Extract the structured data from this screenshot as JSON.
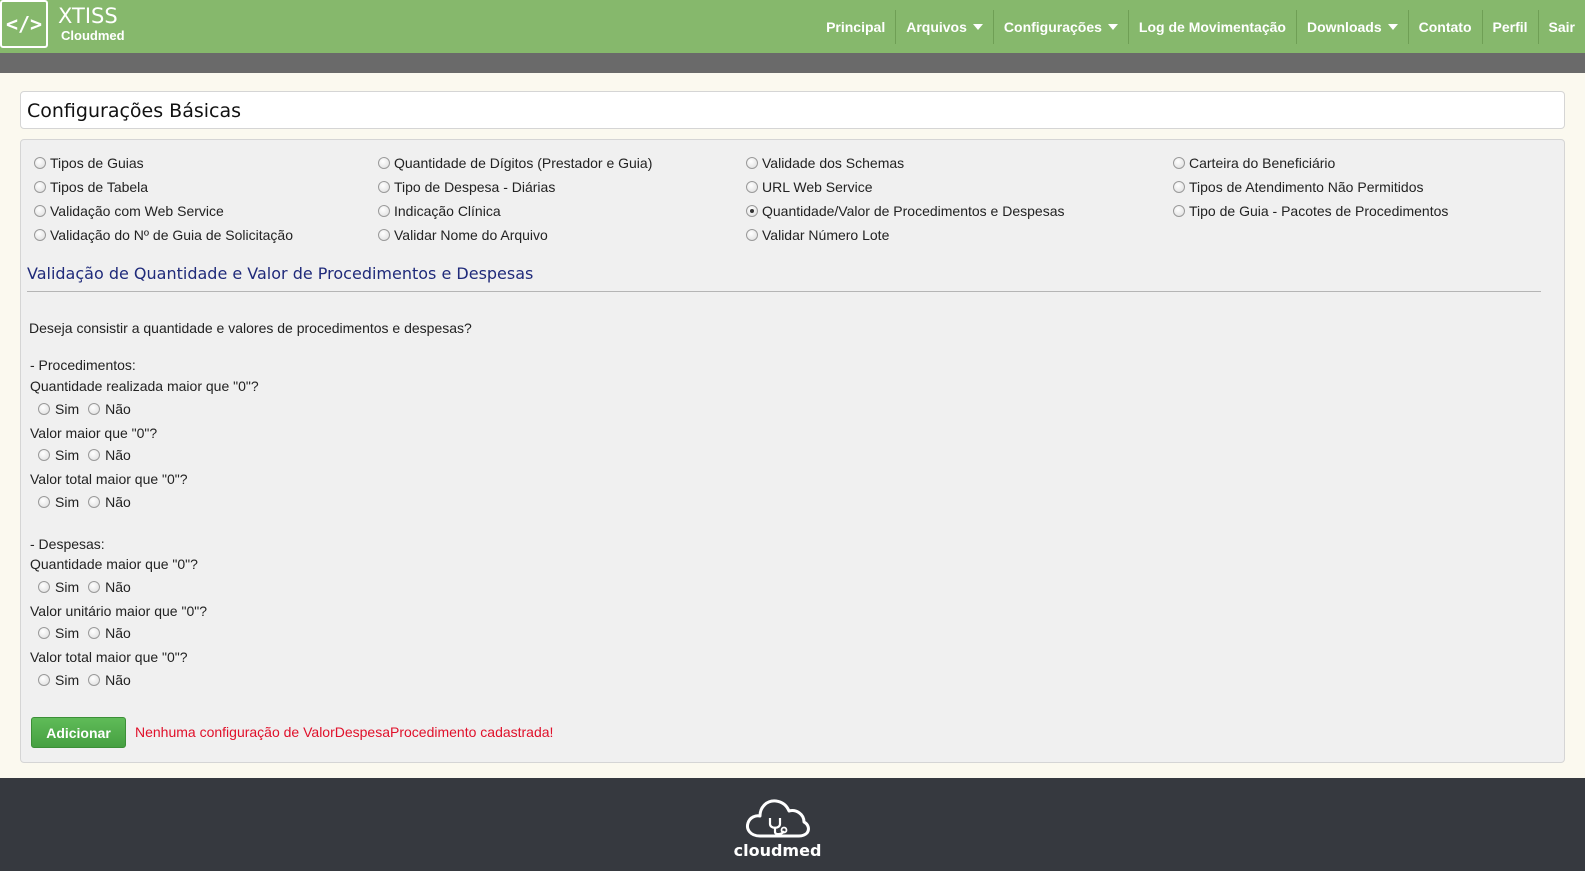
{
  "header": {
    "brand": "XTISS",
    "brand_sub": "Cloudmed",
    "logo_glyph": "</>",
    "nav": [
      {
        "label": "Principal",
        "dropdown": false
      },
      {
        "label": "Arquivos",
        "dropdown": true
      },
      {
        "label": "Configurações",
        "dropdown": true
      },
      {
        "label": "Log de Movimentação",
        "dropdown": false
      },
      {
        "label": "Downloads",
        "dropdown": true
      },
      {
        "label": "Contato",
        "dropdown": false
      },
      {
        "label": "Perfil",
        "dropdown": false
      },
      {
        "label": "Sair",
        "dropdown": false
      }
    ]
  },
  "page_title": "Configurações Básicas",
  "options": [
    {
      "label": "Tipos de Guias",
      "checked": false
    },
    {
      "label": "Tipos de Tabela",
      "checked": false
    },
    {
      "label": "Validação com Web Service",
      "checked": false
    },
    {
      "label": "Validação do Nº de Guia de Solicitação",
      "checked": false
    },
    {
      "label": "Quantidade de Dígitos (Prestador e Guia)",
      "checked": false
    },
    {
      "label": "Tipo de Despesa - Diárias",
      "checked": false
    },
    {
      "label": "Indicação Clínica",
      "checked": false
    },
    {
      "label": "Validar Nome do Arquivo",
      "checked": false
    },
    {
      "label": "Validade dos Schemas",
      "checked": false
    },
    {
      "label": "URL Web Service",
      "checked": false
    },
    {
      "label": "Quantidade/Valor de Procedimentos e Despesas",
      "checked": true
    },
    {
      "label": "Validar Número Lote",
      "checked": false
    },
    {
      "label": "Carteira do Beneficiário",
      "checked": false
    },
    {
      "label": "Tipos de Atendimento Não Permitidos",
      "checked": false
    },
    {
      "label": "Tipo de Guia - Pacotes de Procedimentos",
      "checked": false
    }
  ],
  "section": {
    "title": "Validação de Quantidade e Valor de Procedimentos e Despesas",
    "question": "Deseja consistir a quantidade e valores de procedimentos e despesas?",
    "procedimentos_heading": "- Procedimentos:",
    "despesas_heading": "- Despesas:",
    "procedimentos": [
      "Quantidade realizada maior que \"0\"?",
      "Valor maior que \"0\"?",
      "Valor total maior que \"0\"?"
    ],
    "despesas": [
      "Quantidade maior que \"0\"?",
      "Valor unitário maior que \"0\"?",
      "Valor total maior que \"0\"?"
    ],
    "yes_label": "Sim",
    "no_label": "Não"
  },
  "add_button": "Adicionar",
  "error_message": "Nenhuma configuração de ValorDespesaProcedimento cadastrada!",
  "footer": {
    "brand": "cloudmed"
  },
  "colors": {
    "header": "#86b86c",
    "subbar": "#6a6a6a",
    "footer": "#36393f",
    "section_title": "#1f2a7a",
    "error": "#e0102a",
    "button": "#4aa645"
  }
}
